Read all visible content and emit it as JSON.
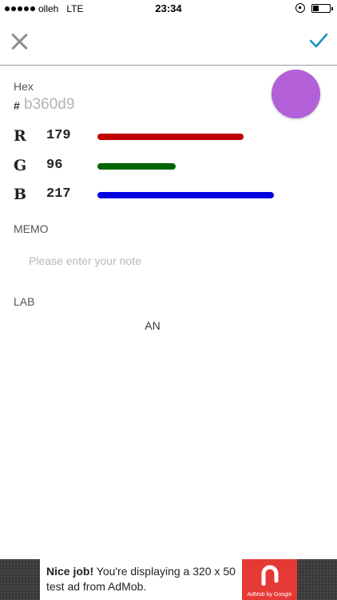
{
  "status_bar": {
    "carrier": "olleh",
    "network": "LTE",
    "time": "23:34"
  },
  "nav": {
    "close_icon": "close-icon",
    "confirm_icon": "checkmark-icon",
    "accent_color": "#1a8fc4"
  },
  "hex": {
    "label": "Hex",
    "hash": "#",
    "value": "b360d9",
    "swatch_color": "#b360d9"
  },
  "rgb": [
    {
      "letter": "R",
      "value": "179",
      "fraction": 0.702,
      "color": "#c00000"
    },
    {
      "letter": "G",
      "value": "96",
      "fraction": 0.376,
      "color": "#006400"
    },
    {
      "letter": "B",
      "value": "217",
      "fraction": 0.851,
      "color": "#0000e0"
    }
  ],
  "memo": {
    "label": "MEMO",
    "placeholder": "Please enter your note"
  },
  "lab": {
    "label": "LAB",
    "value": "AN"
  },
  "ad": {
    "bold": "Nice job!",
    "text": " You're displaying a 320 x 50 test ad from AdMob.",
    "brand": "AdMob by Google"
  }
}
